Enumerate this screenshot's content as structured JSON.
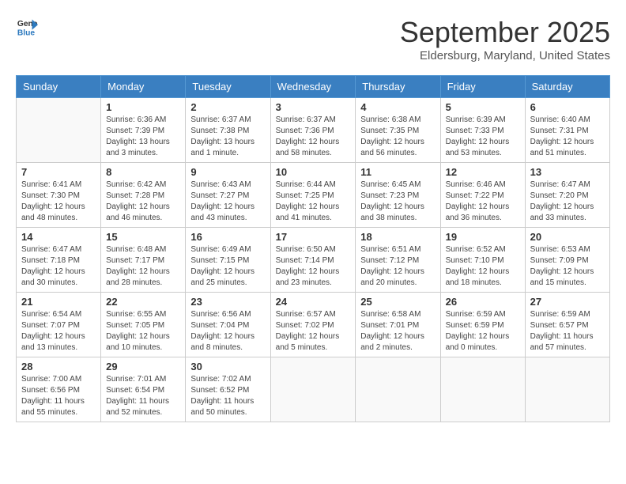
{
  "header": {
    "logo_line1": "General",
    "logo_line2": "Blue",
    "month": "September 2025",
    "location": "Eldersburg, Maryland, United States"
  },
  "days_of_week": [
    "Sunday",
    "Monday",
    "Tuesday",
    "Wednesday",
    "Thursday",
    "Friday",
    "Saturday"
  ],
  "weeks": [
    [
      {
        "num": "",
        "text": ""
      },
      {
        "num": "1",
        "text": "Sunrise: 6:36 AM\nSunset: 7:39 PM\nDaylight: 13 hours\nand 3 minutes."
      },
      {
        "num": "2",
        "text": "Sunrise: 6:37 AM\nSunset: 7:38 PM\nDaylight: 13 hours\nand 1 minute."
      },
      {
        "num": "3",
        "text": "Sunrise: 6:37 AM\nSunset: 7:36 PM\nDaylight: 12 hours\nand 58 minutes."
      },
      {
        "num": "4",
        "text": "Sunrise: 6:38 AM\nSunset: 7:35 PM\nDaylight: 12 hours\nand 56 minutes."
      },
      {
        "num": "5",
        "text": "Sunrise: 6:39 AM\nSunset: 7:33 PM\nDaylight: 12 hours\nand 53 minutes."
      },
      {
        "num": "6",
        "text": "Sunrise: 6:40 AM\nSunset: 7:31 PM\nDaylight: 12 hours\nand 51 minutes."
      }
    ],
    [
      {
        "num": "7",
        "text": "Sunrise: 6:41 AM\nSunset: 7:30 PM\nDaylight: 12 hours\nand 48 minutes."
      },
      {
        "num": "8",
        "text": "Sunrise: 6:42 AM\nSunset: 7:28 PM\nDaylight: 12 hours\nand 46 minutes."
      },
      {
        "num": "9",
        "text": "Sunrise: 6:43 AM\nSunset: 7:27 PM\nDaylight: 12 hours\nand 43 minutes."
      },
      {
        "num": "10",
        "text": "Sunrise: 6:44 AM\nSunset: 7:25 PM\nDaylight: 12 hours\nand 41 minutes."
      },
      {
        "num": "11",
        "text": "Sunrise: 6:45 AM\nSunset: 7:23 PM\nDaylight: 12 hours\nand 38 minutes."
      },
      {
        "num": "12",
        "text": "Sunrise: 6:46 AM\nSunset: 7:22 PM\nDaylight: 12 hours\nand 36 minutes."
      },
      {
        "num": "13",
        "text": "Sunrise: 6:47 AM\nSunset: 7:20 PM\nDaylight: 12 hours\nand 33 minutes."
      }
    ],
    [
      {
        "num": "14",
        "text": "Sunrise: 6:47 AM\nSunset: 7:18 PM\nDaylight: 12 hours\nand 30 minutes."
      },
      {
        "num": "15",
        "text": "Sunrise: 6:48 AM\nSunset: 7:17 PM\nDaylight: 12 hours\nand 28 minutes."
      },
      {
        "num": "16",
        "text": "Sunrise: 6:49 AM\nSunset: 7:15 PM\nDaylight: 12 hours\nand 25 minutes."
      },
      {
        "num": "17",
        "text": "Sunrise: 6:50 AM\nSunset: 7:14 PM\nDaylight: 12 hours\nand 23 minutes."
      },
      {
        "num": "18",
        "text": "Sunrise: 6:51 AM\nSunset: 7:12 PM\nDaylight: 12 hours\nand 20 minutes."
      },
      {
        "num": "19",
        "text": "Sunrise: 6:52 AM\nSunset: 7:10 PM\nDaylight: 12 hours\nand 18 minutes."
      },
      {
        "num": "20",
        "text": "Sunrise: 6:53 AM\nSunset: 7:09 PM\nDaylight: 12 hours\nand 15 minutes."
      }
    ],
    [
      {
        "num": "21",
        "text": "Sunrise: 6:54 AM\nSunset: 7:07 PM\nDaylight: 12 hours\nand 13 minutes."
      },
      {
        "num": "22",
        "text": "Sunrise: 6:55 AM\nSunset: 7:05 PM\nDaylight: 12 hours\nand 10 minutes."
      },
      {
        "num": "23",
        "text": "Sunrise: 6:56 AM\nSunset: 7:04 PM\nDaylight: 12 hours\nand 8 minutes."
      },
      {
        "num": "24",
        "text": "Sunrise: 6:57 AM\nSunset: 7:02 PM\nDaylight: 12 hours\nand 5 minutes."
      },
      {
        "num": "25",
        "text": "Sunrise: 6:58 AM\nSunset: 7:01 PM\nDaylight: 12 hours\nand 2 minutes."
      },
      {
        "num": "26",
        "text": "Sunrise: 6:59 AM\nSunset: 6:59 PM\nDaylight: 12 hours\nand 0 minutes."
      },
      {
        "num": "27",
        "text": "Sunrise: 6:59 AM\nSunset: 6:57 PM\nDaylight: 11 hours\nand 57 minutes."
      }
    ],
    [
      {
        "num": "28",
        "text": "Sunrise: 7:00 AM\nSunset: 6:56 PM\nDaylight: 11 hours\nand 55 minutes."
      },
      {
        "num": "29",
        "text": "Sunrise: 7:01 AM\nSunset: 6:54 PM\nDaylight: 11 hours\nand 52 minutes."
      },
      {
        "num": "30",
        "text": "Sunrise: 7:02 AM\nSunset: 6:52 PM\nDaylight: 11 hours\nand 50 minutes."
      },
      {
        "num": "",
        "text": ""
      },
      {
        "num": "",
        "text": ""
      },
      {
        "num": "",
        "text": ""
      },
      {
        "num": "",
        "text": ""
      }
    ]
  ]
}
